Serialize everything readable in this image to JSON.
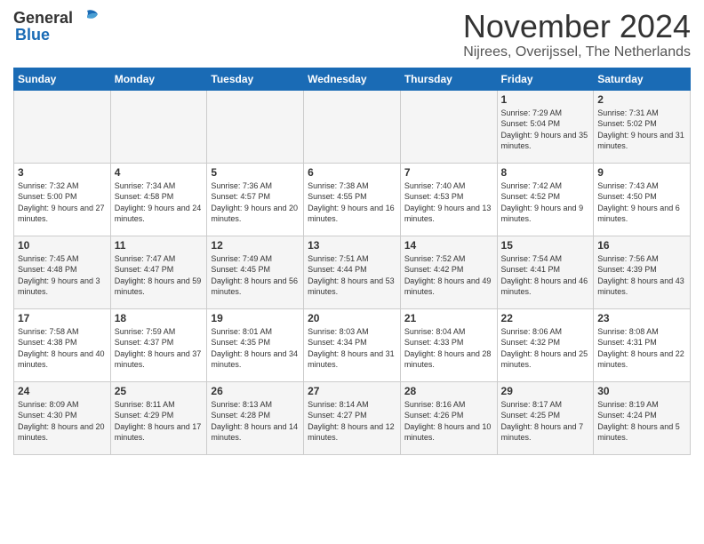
{
  "header": {
    "logo_general": "General",
    "logo_blue": "Blue",
    "month_title": "November 2024",
    "subtitle": "Nijrees, Overijssel, The Netherlands"
  },
  "weekdays": [
    "Sunday",
    "Monday",
    "Tuesday",
    "Wednesday",
    "Thursday",
    "Friday",
    "Saturday"
  ],
  "weeks": [
    [
      {
        "day": "",
        "info": ""
      },
      {
        "day": "",
        "info": ""
      },
      {
        "day": "",
        "info": ""
      },
      {
        "day": "",
        "info": ""
      },
      {
        "day": "",
        "info": ""
      },
      {
        "day": "1",
        "info": "Sunrise: 7:29 AM\nSunset: 5:04 PM\nDaylight: 9 hours and 35 minutes."
      },
      {
        "day": "2",
        "info": "Sunrise: 7:31 AM\nSunset: 5:02 PM\nDaylight: 9 hours and 31 minutes."
      }
    ],
    [
      {
        "day": "3",
        "info": "Sunrise: 7:32 AM\nSunset: 5:00 PM\nDaylight: 9 hours and 27 minutes."
      },
      {
        "day": "4",
        "info": "Sunrise: 7:34 AM\nSunset: 4:58 PM\nDaylight: 9 hours and 24 minutes."
      },
      {
        "day": "5",
        "info": "Sunrise: 7:36 AM\nSunset: 4:57 PM\nDaylight: 9 hours and 20 minutes."
      },
      {
        "day": "6",
        "info": "Sunrise: 7:38 AM\nSunset: 4:55 PM\nDaylight: 9 hours and 16 minutes."
      },
      {
        "day": "7",
        "info": "Sunrise: 7:40 AM\nSunset: 4:53 PM\nDaylight: 9 hours and 13 minutes."
      },
      {
        "day": "8",
        "info": "Sunrise: 7:42 AM\nSunset: 4:52 PM\nDaylight: 9 hours and 9 minutes."
      },
      {
        "day": "9",
        "info": "Sunrise: 7:43 AM\nSunset: 4:50 PM\nDaylight: 9 hours and 6 minutes."
      }
    ],
    [
      {
        "day": "10",
        "info": "Sunrise: 7:45 AM\nSunset: 4:48 PM\nDaylight: 9 hours and 3 minutes."
      },
      {
        "day": "11",
        "info": "Sunrise: 7:47 AM\nSunset: 4:47 PM\nDaylight: 8 hours and 59 minutes."
      },
      {
        "day": "12",
        "info": "Sunrise: 7:49 AM\nSunset: 4:45 PM\nDaylight: 8 hours and 56 minutes."
      },
      {
        "day": "13",
        "info": "Sunrise: 7:51 AM\nSunset: 4:44 PM\nDaylight: 8 hours and 53 minutes."
      },
      {
        "day": "14",
        "info": "Sunrise: 7:52 AM\nSunset: 4:42 PM\nDaylight: 8 hours and 49 minutes."
      },
      {
        "day": "15",
        "info": "Sunrise: 7:54 AM\nSunset: 4:41 PM\nDaylight: 8 hours and 46 minutes."
      },
      {
        "day": "16",
        "info": "Sunrise: 7:56 AM\nSunset: 4:39 PM\nDaylight: 8 hours and 43 minutes."
      }
    ],
    [
      {
        "day": "17",
        "info": "Sunrise: 7:58 AM\nSunset: 4:38 PM\nDaylight: 8 hours and 40 minutes."
      },
      {
        "day": "18",
        "info": "Sunrise: 7:59 AM\nSunset: 4:37 PM\nDaylight: 8 hours and 37 minutes."
      },
      {
        "day": "19",
        "info": "Sunrise: 8:01 AM\nSunset: 4:35 PM\nDaylight: 8 hours and 34 minutes."
      },
      {
        "day": "20",
        "info": "Sunrise: 8:03 AM\nSunset: 4:34 PM\nDaylight: 8 hours and 31 minutes."
      },
      {
        "day": "21",
        "info": "Sunrise: 8:04 AM\nSunset: 4:33 PM\nDaylight: 8 hours and 28 minutes."
      },
      {
        "day": "22",
        "info": "Sunrise: 8:06 AM\nSunset: 4:32 PM\nDaylight: 8 hours and 25 minutes."
      },
      {
        "day": "23",
        "info": "Sunrise: 8:08 AM\nSunset: 4:31 PM\nDaylight: 8 hours and 22 minutes."
      }
    ],
    [
      {
        "day": "24",
        "info": "Sunrise: 8:09 AM\nSunset: 4:30 PM\nDaylight: 8 hours and 20 minutes."
      },
      {
        "day": "25",
        "info": "Sunrise: 8:11 AM\nSunset: 4:29 PM\nDaylight: 8 hours and 17 minutes."
      },
      {
        "day": "26",
        "info": "Sunrise: 8:13 AM\nSunset: 4:28 PM\nDaylight: 8 hours and 14 minutes."
      },
      {
        "day": "27",
        "info": "Sunrise: 8:14 AM\nSunset: 4:27 PM\nDaylight: 8 hours and 12 minutes."
      },
      {
        "day": "28",
        "info": "Sunrise: 8:16 AM\nSunset: 4:26 PM\nDaylight: 8 hours and 10 minutes."
      },
      {
        "day": "29",
        "info": "Sunrise: 8:17 AM\nSunset: 4:25 PM\nDaylight: 8 hours and 7 minutes."
      },
      {
        "day": "30",
        "info": "Sunrise: 8:19 AM\nSunset: 4:24 PM\nDaylight: 8 hours and 5 minutes."
      }
    ]
  ]
}
